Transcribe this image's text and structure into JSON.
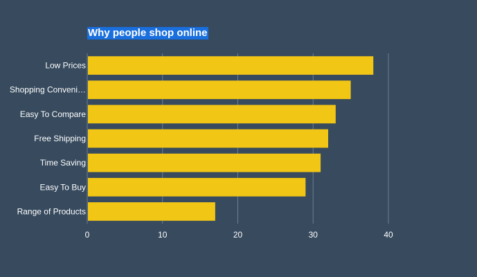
{
  "chart_data": {
    "type": "bar",
    "orientation": "horizontal",
    "title": "Why people shop online",
    "categories": [
      "Low Prices",
      "Shopping Conveni…",
      "Easy To Compare",
      "Free Shipping",
      "Time Saving",
      "Easy To Buy",
      "Range of Products"
    ],
    "values": [
      38,
      35,
      33,
      32,
      31,
      29,
      17
    ],
    "xlim": [
      0,
      40
    ],
    "xticks": [
      0,
      10,
      20,
      30,
      40
    ],
    "xlabel": "",
    "ylabel": "",
    "grid": true,
    "legend": "none",
    "colors": {
      "bar": "#f2c614",
      "background": "#374a5e",
      "grid": "#6f7f8f",
      "title_highlight": "#1a6fde",
      "text": "#ffffff"
    }
  }
}
